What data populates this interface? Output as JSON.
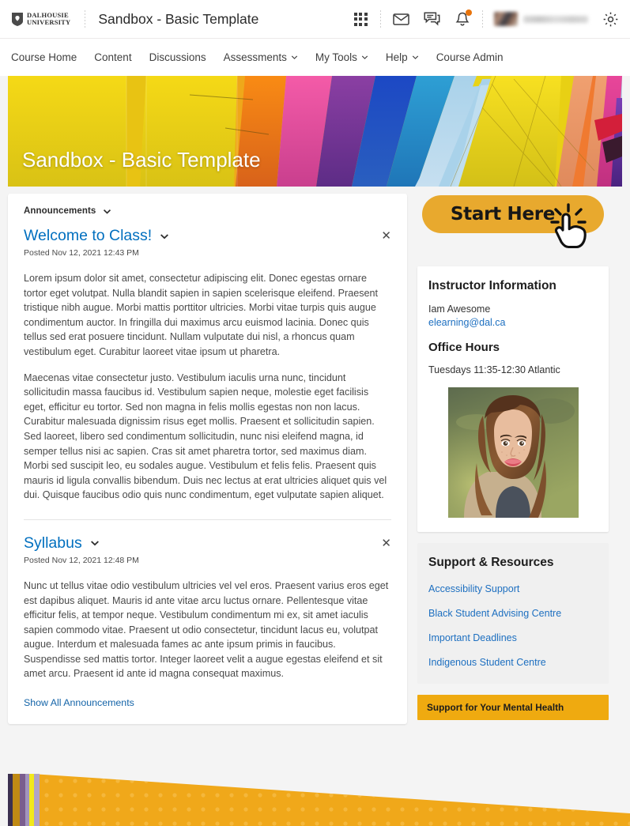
{
  "topbar": {
    "logo_line1": "DALHOUSIE",
    "logo_line2": "UNIVERSITY",
    "course_title": "Sandbox - Basic Template",
    "icons": [
      {
        "name": "waffle-apps-icon",
        "label": "Course Selector"
      },
      {
        "name": "envelope-icon",
        "label": "Email"
      },
      {
        "name": "chat-icon",
        "label": "Subscriptions"
      },
      {
        "name": "bell-icon",
        "label": "Notifications"
      },
      {
        "name": "gear-icon",
        "label": "Settings"
      }
    ],
    "notification_badge": true
  },
  "nav": {
    "items": [
      {
        "label": "Course Home",
        "dropdown": false
      },
      {
        "label": "Content",
        "dropdown": false
      },
      {
        "label": "Discussions",
        "dropdown": false
      },
      {
        "label": "Assessments",
        "dropdown": true
      },
      {
        "label": "My Tools",
        "dropdown": true
      },
      {
        "label": "Help",
        "dropdown": true
      },
      {
        "label": "Course Admin",
        "dropdown": false
      }
    ]
  },
  "banner": {
    "title": "Sandbox - Basic Template",
    "alt": "Colourful hot air balloon panels"
  },
  "announcements": {
    "widget_label": "Announcements",
    "show_all_label": "Show All Announcements",
    "items": [
      {
        "title": "Welcome to Class!",
        "posted": "Posted Nov 12, 2021 12:43 PM",
        "paragraphs": [
          "Lorem ipsum dolor sit amet, consectetur adipiscing elit. Donec egestas ornare tortor eget volutpat. Nulla blandit sapien in sapien scelerisque eleifend. Praesent tristique nibh augue. Morbi mattis porttitor ultricies. Morbi vitae turpis quis augue condimentum auctor. In fringilla dui maximus arcu euismod lacinia. Donec quis tellus sed erat posuere tincidunt. Nullam vulputate dui nisl, a rhoncus quam vestibulum eget. Curabitur laoreet vitae ipsum ut pharetra.",
          "Maecenas vitae consectetur justo. Vestibulum iaculis urna nunc, tincidunt sollicitudin massa faucibus id. Vestibulum sapien neque, molestie eget facilisis eget, efficitur eu tortor. Sed non magna in felis mollis egestas non non lacus. Curabitur malesuada dignissim risus eget mollis. Praesent et sollicitudin sapien. Sed laoreet, libero sed condimentum sollicitudin, nunc nisi eleifend magna, id semper tellus nisi ac sapien. Cras sit amet pharetra tortor, sed maximus diam. Morbi sed suscipit leo, eu sodales augue. Vestibulum et felis felis. Praesent quis mauris id ligula convallis bibendum. Duis nec lectus at erat ultricies aliquet quis vel dui. Quisque faucibus odio quis nunc condimentum, eget vulputate sapien aliquet."
        ]
      },
      {
        "title": "Syllabus",
        "posted": "Posted Nov 12, 2021 12:48 PM",
        "paragraphs": [
          "Nunc ut tellus vitae odio vestibulum ultricies vel vel eros. Praesent varius eros eget est dapibus aliquet. Mauris id ante vitae arcu luctus ornare. Pellentesque vitae efficitur felis, at tempor neque. Vestibulum condimentum mi ex, sit amet iaculis sapien commodo vitae. Praesent ut odio consectetur, tincidunt lacus eu, volutpat augue. Interdum et malesuada fames ac ante ipsum primis in faucibus. Suspendisse sed mattis tortor. Integer laoreet velit a augue egestas eleifend et sit amet arcu. Praesent id ante id magna consequat maximus."
        ]
      }
    ]
  },
  "sidebar": {
    "start_here": {
      "label": "Start Here",
      "color": "#e8a92e"
    },
    "instructor": {
      "heading": "Instructor Information",
      "name": "Iam Awesome",
      "email": "elearning@dal.ca",
      "office_heading": "Office Hours",
      "office_hours": "Tuesdays 11:35-12:30 Atlantic",
      "photo_alt": "Instructor portrait"
    },
    "support": {
      "heading": "Support & Resources",
      "links": [
        "Accessibility Support",
        "Black Student Advising Centre",
        "Important Deadlines",
        "Indigenous Student Centre"
      ],
      "mental_health_label": "Support for Your Mental Health",
      "mental_health_color": "#efaa10"
    }
  },
  "footer": {
    "stripe_colors": [
      "#3b3050",
      "#c08a14",
      "#7a5d8e",
      "#a294bd",
      "#f2e81b",
      "#b0a3c6"
    ],
    "wedge_color": "#f0a81a"
  }
}
